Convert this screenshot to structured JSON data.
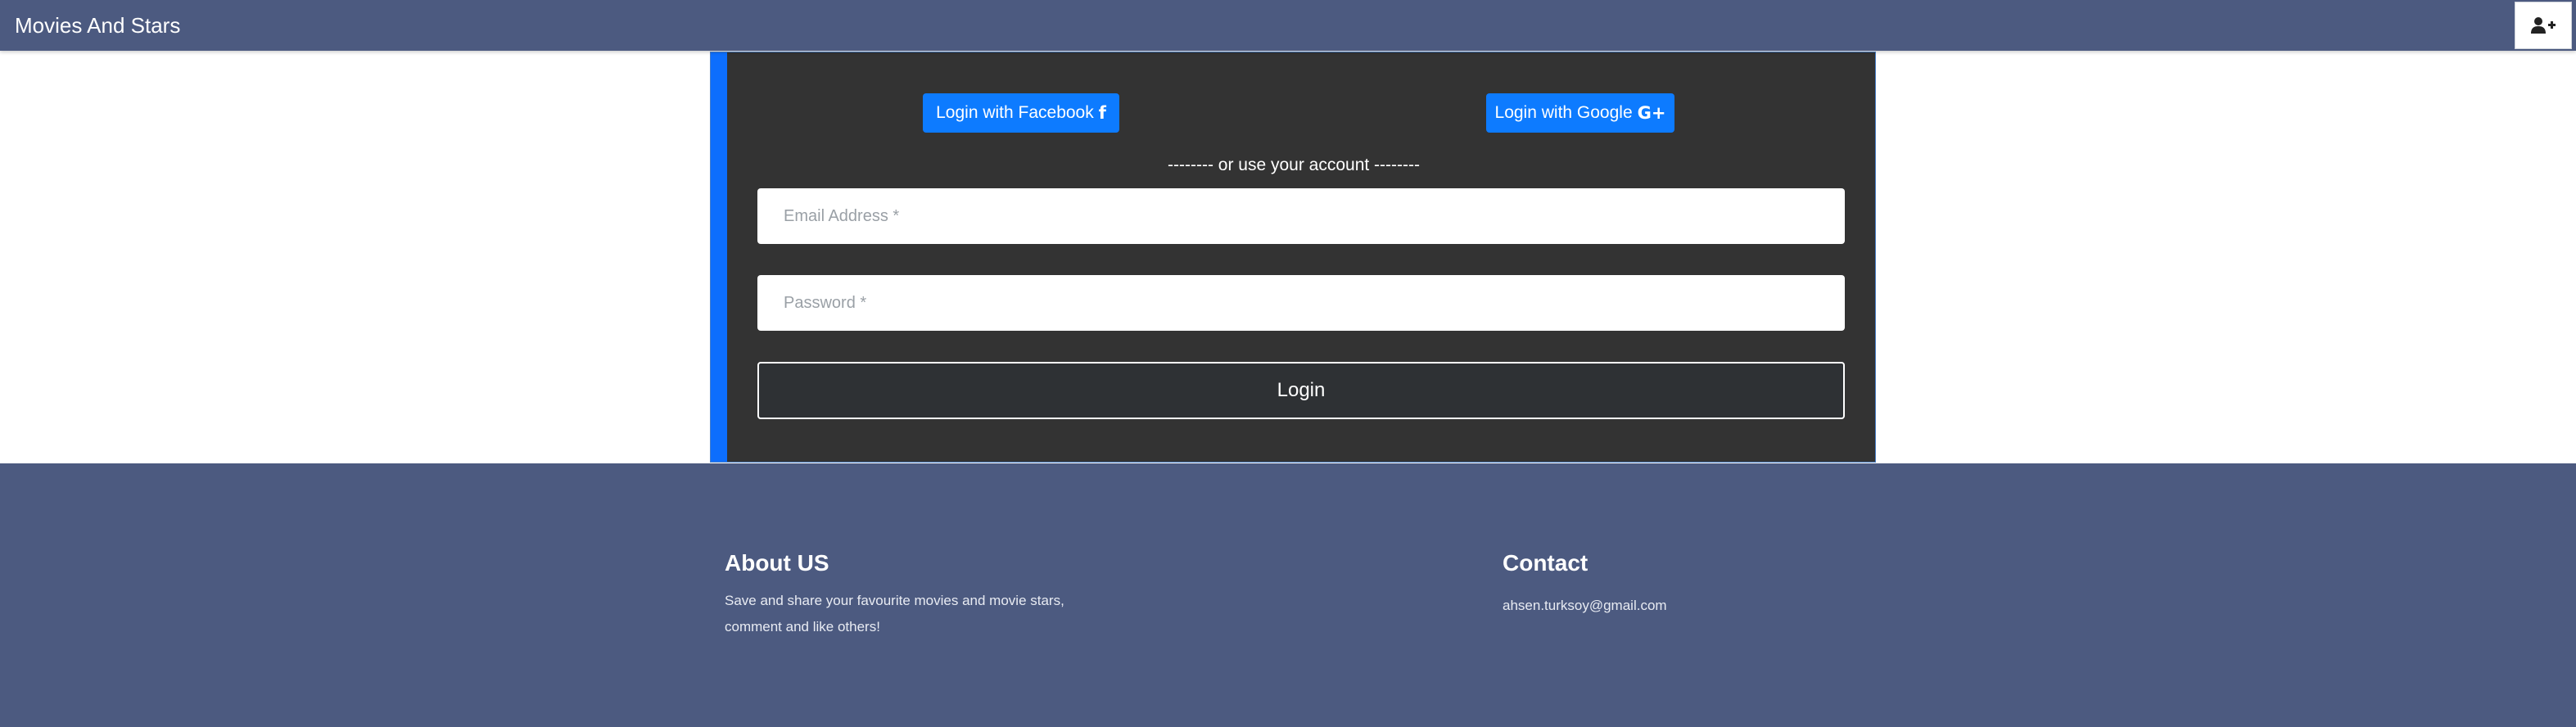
{
  "navbar": {
    "brand": "Movies And Stars",
    "signup_icon": "user-plus-icon"
  },
  "login": {
    "facebook_label": "Login with Facebook",
    "facebook_icon": "f",
    "google_label": "Login with Google",
    "google_icon": "G+",
    "divider": "-------- or use your account --------",
    "email_placeholder": "Email Address *",
    "email_value": "",
    "password_placeholder": "Password *",
    "password_value": "",
    "login_label": "Login"
  },
  "footer": {
    "about_heading": "About US",
    "about_text": "Save and share your favourite movies and movie stars, comment and like others!",
    "contact_heading": "Contact",
    "contact_email": "ahsen.turksoy@gmail.com"
  },
  "colors": {
    "navbar_bg": "#4c5a80",
    "card_bg": "#333333",
    "accent_blue": "#0d7bff",
    "login_btn_bg": "#2e3134"
  }
}
